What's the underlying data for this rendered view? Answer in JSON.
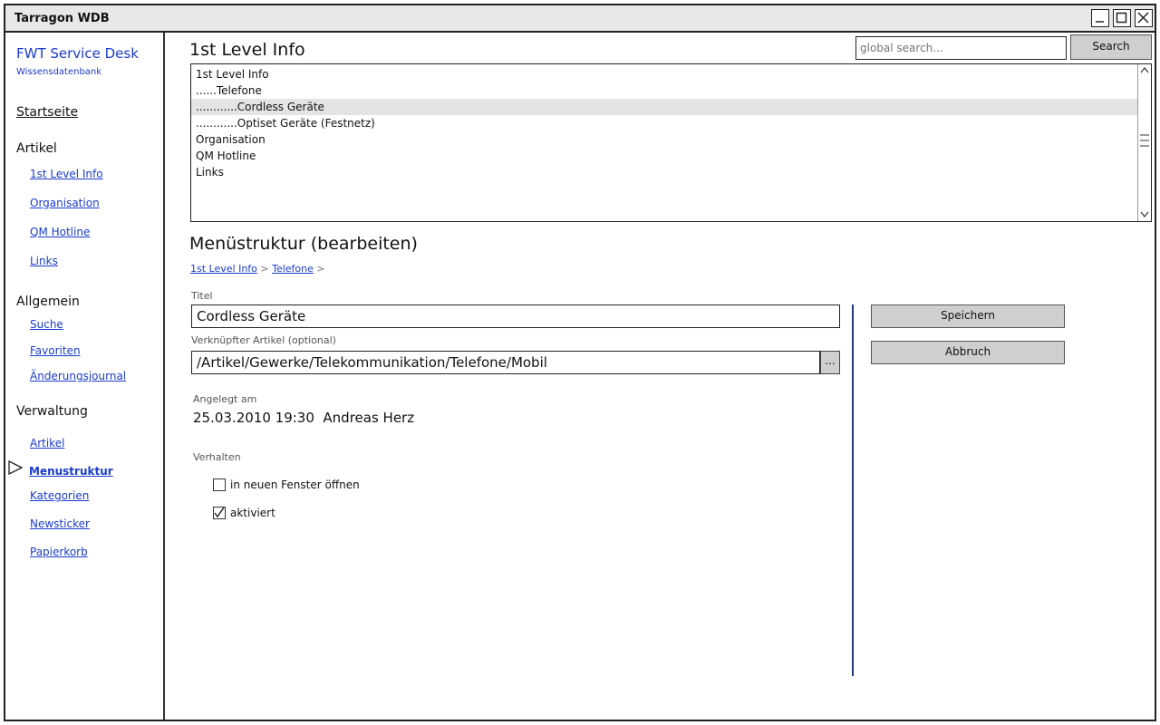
{
  "window": {
    "title": "Tarragon WDB"
  },
  "sidebar": {
    "brand": "FWT Service Desk",
    "subtitle": "Wissensdatenbank",
    "home": "Startseite",
    "artikel_head": "Artikel",
    "artikel_items": [
      "1st Level Info",
      "Organisation",
      "QM Hotline",
      "Links"
    ],
    "allgemein_head": "Allgemein",
    "allgemein_items": [
      "Suche",
      "Favoriten",
      "Änderungsjournal"
    ],
    "verwaltung_head": "Verwaltung",
    "verwaltung_items": [
      "Artikel",
      "Menustruktur",
      "Kategorien",
      "Newsticker",
      "Papierkorb"
    ],
    "active_item": "Menustruktur"
  },
  "header": {
    "page_title": "1st Level Info",
    "search_placeholder": "global search...",
    "search_button": "Search"
  },
  "tree": {
    "rows": [
      "1st Level Info",
      "......Telefone",
      "............Cordless Geräte",
      "............Optiset Geräte (Festnetz)",
      "Organisation",
      "QM Hotline",
      "Links"
    ],
    "selected_index": 2
  },
  "editor": {
    "section_title": "Menüstruktur (bearbeiten)",
    "breadcrumb": [
      "1st Level Info",
      "Telefone"
    ],
    "breadcrumb_sep": ">",
    "titel_label": "Titel",
    "titel_value": "Cordless Geräte",
    "artikel_label": "Verknüpfter Artikel (optional)",
    "artikel_value": "/Artikel/Gewerke/Telekommunikation/Telefone/Mobil",
    "browse_label": "...",
    "angelegt_label": "Angelegt am",
    "angelegt_value": "25.03.2010 19:30  Andreas Herz",
    "verhalten_label": "Verhalten",
    "checkbox_new_window": {
      "label": "in neuen Fenster öffnen",
      "checked": false
    },
    "checkbox_active": {
      "label": "aktiviert",
      "checked": true
    }
  },
  "actions": {
    "save": "Speichern",
    "cancel": "Abbruch"
  }
}
